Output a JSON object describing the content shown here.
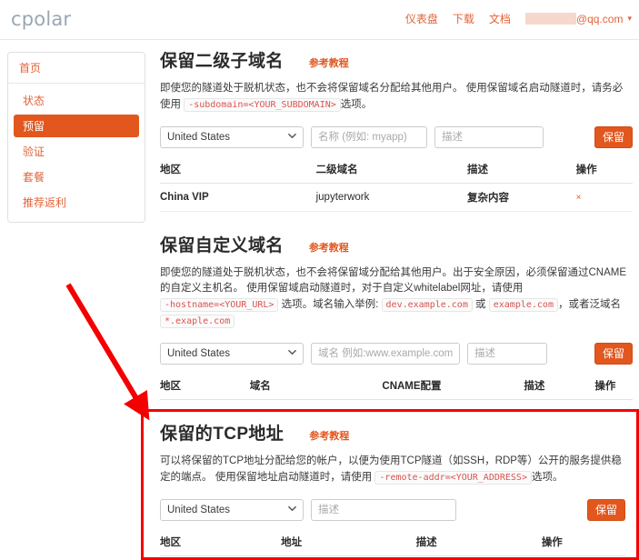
{
  "topbar": {
    "brand": "cpolar",
    "nav": [
      {
        "label": "仪表盘",
        "name": "nav-dashboard"
      },
      {
        "label": "下载",
        "name": "nav-download"
      },
      {
        "label": "文档",
        "name": "nav-docs"
      }
    ],
    "user_email_suffix": "@qq.com",
    "caret": "▾"
  },
  "sidebar": {
    "home": "首页",
    "items": [
      {
        "label": "状态",
        "active": false
      },
      {
        "label": "预留",
        "active": true
      },
      {
        "label": "验证",
        "active": false
      },
      {
        "label": "套餐",
        "active": false
      },
      {
        "label": "推荐返利",
        "active": false
      }
    ]
  },
  "sections": {
    "subdomain": {
      "title": "保留二级子域名",
      "tutorial": "参考教程",
      "desc_part1": "即使您的隧道处于脱机状态，也不会将保留域名分配给其他用户。 使用保留域名启动隧道时，请务必使用",
      "code1": "-subdomain=<YOUR_SUBDOMAIN>",
      "desc_part2": "选项。",
      "region_value": "United States",
      "name_placeholder": "名称 (例如: myapp)",
      "desc_placeholder": "描述",
      "reserve_label": "保留",
      "columns": [
        "地区",
        "二级域名",
        "描述",
        "操作"
      ],
      "rows": [
        {
          "region": "China VIP",
          "domain": "jupyterwork",
          "desc": "复杂内容",
          "action": "×"
        }
      ]
    },
    "custom_domain": {
      "title": "保留自定义域名",
      "tutorial": "参考教程",
      "desc_part1": "即使您的隧道处于脱机状态，也不会将保留域分配给其他用户。出于安全原因，必须保留通过CNAME的自定义主机名。 使用保留域启动隧道时，对于自定义whitelabel网址，请使用",
      "code1": "-hostname=<YOUR_URL>",
      "desc_part2": "选项。域名输入举例:",
      "code2": "dev.example.com",
      "desc_part3": "或",
      "code3": "example.com",
      "desc_part4": "，或者泛域名",
      "code4": "*.exaple.com",
      "region_value": "United States",
      "domain_placeholder": "域名 例如:www.example.com",
      "desc_placeholder": "描述",
      "reserve_label": "保留",
      "columns": [
        "地区",
        "域名",
        "CNAME配置",
        "描述",
        "操作"
      ],
      "rows": []
    },
    "tcp": {
      "title": "保留的TCP地址",
      "tutorial": "参考教程",
      "desc_part1": "可以将保留的TCP地址分配给您的帐户，以便为使用TCP隧道（如SSH，RDP等）公开的服务提供稳定的端点。 使用保留地址启动隧道时，请使用",
      "code1": "-remote-addr=<YOUR_ADDRESS>",
      "desc_part2": "选项。",
      "region_value": "United States",
      "desc_placeholder": "描述",
      "reserve_label": "保留",
      "columns": [
        "地区",
        "地址",
        "描述",
        "操作"
      ],
      "rows": []
    }
  },
  "annotation": {
    "highlight_color": "#f50000",
    "arrow_color": "#f50000"
  },
  "colors": {
    "accent": "#e2571e",
    "link": "#e2643a",
    "brand": "#9aa7b3"
  }
}
